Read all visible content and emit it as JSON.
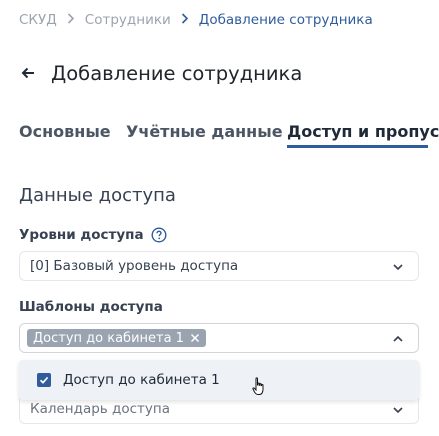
{
  "breadcrumb": {
    "items": [
      "СКУД",
      "Сотрудники"
    ],
    "current": "Добавление сотрудника"
  },
  "header": {
    "title": "Добавление сотрудника",
    "back_icon": "arrow-left-icon"
  },
  "tabs": [
    {
      "label": "Основные",
      "active": false
    },
    {
      "label": "Учётные данные",
      "active": false
    },
    {
      "label": "Доступ и пропуск",
      "active": true
    }
  ],
  "section": {
    "title": "Данные доступа"
  },
  "access_levels": {
    "label": "Уровни доступа",
    "help_icon": "question-circle-icon",
    "value": "[0] Базовый уровень доступа"
  },
  "access_templates": {
    "label": "Шаблоны доступа",
    "chips": [
      "Доступ до кабинета 1"
    ],
    "open": true,
    "options": [
      {
        "label": "Доступ до кабинета 1",
        "checked": true
      }
    ]
  },
  "calendar": {
    "placeholder": "Календарь доступа"
  },
  "colors": {
    "accent": "#2f5c9b",
    "chip": "#9aa3b0",
    "dropdown_bg": "#eef1f5"
  }
}
